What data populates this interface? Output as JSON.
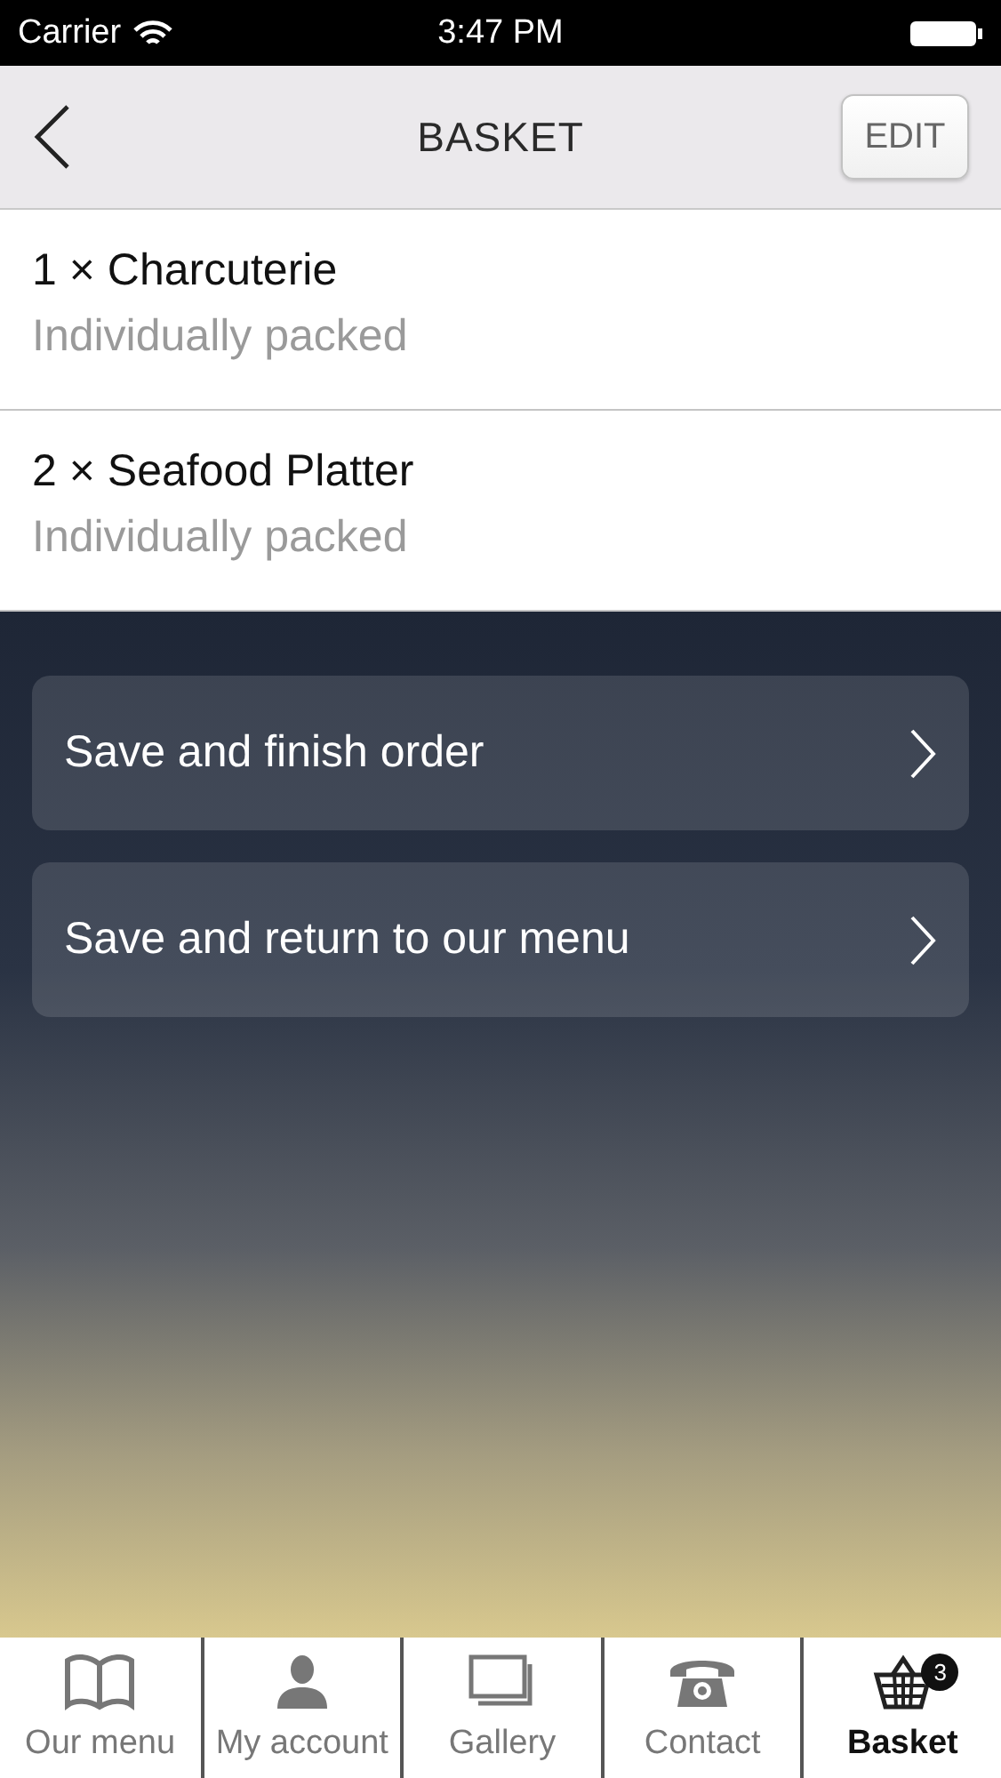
{
  "status_bar": {
    "carrier": "Carrier",
    "time": "3:47 PM"
  },
  "nav": {
    "title": "BASKET",
    "edit_button": "EDIT"
  },
  "items": [
    {
      "title": "1 × Charcuterie",
      "subtitle": "Individually packed"
    },
    {
      "title": "2 × Seafood Platter",
      "subtitle": "Individually packed"
    }
  ],
  "actions": [
    "Save and finish order",
    "Save and return to our menu"
  ],
  "tabs": [
    {
      "kind": "book",
      "label": "Our menu",
      "selected": false
    },
    {
      "kind": "person",
      "label": "My account",
      "selected": false
    },
    {
      "kind": "photos",
      "label": "Gallery",
      "selected": false
    },
    {
      "kind": "phone",
      "label": "Contact",
      "selected": false
    },
    {
      "kind": "basket",
      "label": "Basket",
      "selected": true,
      "badge": "3"
    }
  ]
}
